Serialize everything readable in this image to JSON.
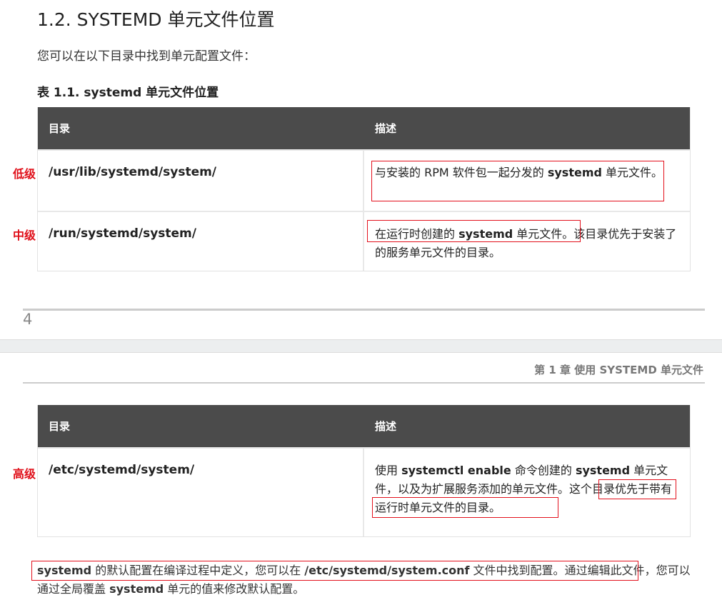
{
  "section_title": "1.2. SYSTEMD 单元文件位置",
  "intro": "您可以在以下目录中找到单元配置文件：",
  "table_caption": "表 1.1. systemd 单元文件位置",
  "columns": [
    "目录",
    "描述"
  ],
  "rows": [
    {
      "level": "低级",
      "dir": "/usr/lib/systemd/system/",
      "desc_parts": [
        "与安装的 RPM 软件包一起分发的 ",
        "systemd",
        " 单元文件。"
      ]
    },
    {
      "level": "中级",
      "dir": "/run/systemd/system/",
      "desc_parts": [
        "在运行时创建的 ",
        "systemd",
        " 单元文件",
        "。该目录优先于安装了的服务单元文件的目录。"
      ]
    },
    {
      "level": "高级",
      "dir": "/etc/systemd/system/",
      "desc_parts": [
        "使用 ",
        "systemctl enable",
        " 命令创建的 ",
        "systemd",
        " 单元文件，以及为扩展服务添加的单元文件。",
        "这个目录优先于带有运行时单元文件的目录。"
      ]
    }
  ],
  "page_number": "4",
  "running_header": "第 1 章 使用 SYSTEMD 单元文件",
  "footer_parts": [
    "systemd",
    " 的默认配置在编译过程中定义，您可以在 ",
    "/etc/systemd/system.conf",
    " 文件中找到配置。",
    "通过编辑此文件，您可以通过全局覆盖 ",
    "systemd",
    " 单元的值来修改默认配置。"
  ],
  "colors": {
    "annotation_red": "#e3111d",
    "table_header": "#4b4b4b"
  }
}
